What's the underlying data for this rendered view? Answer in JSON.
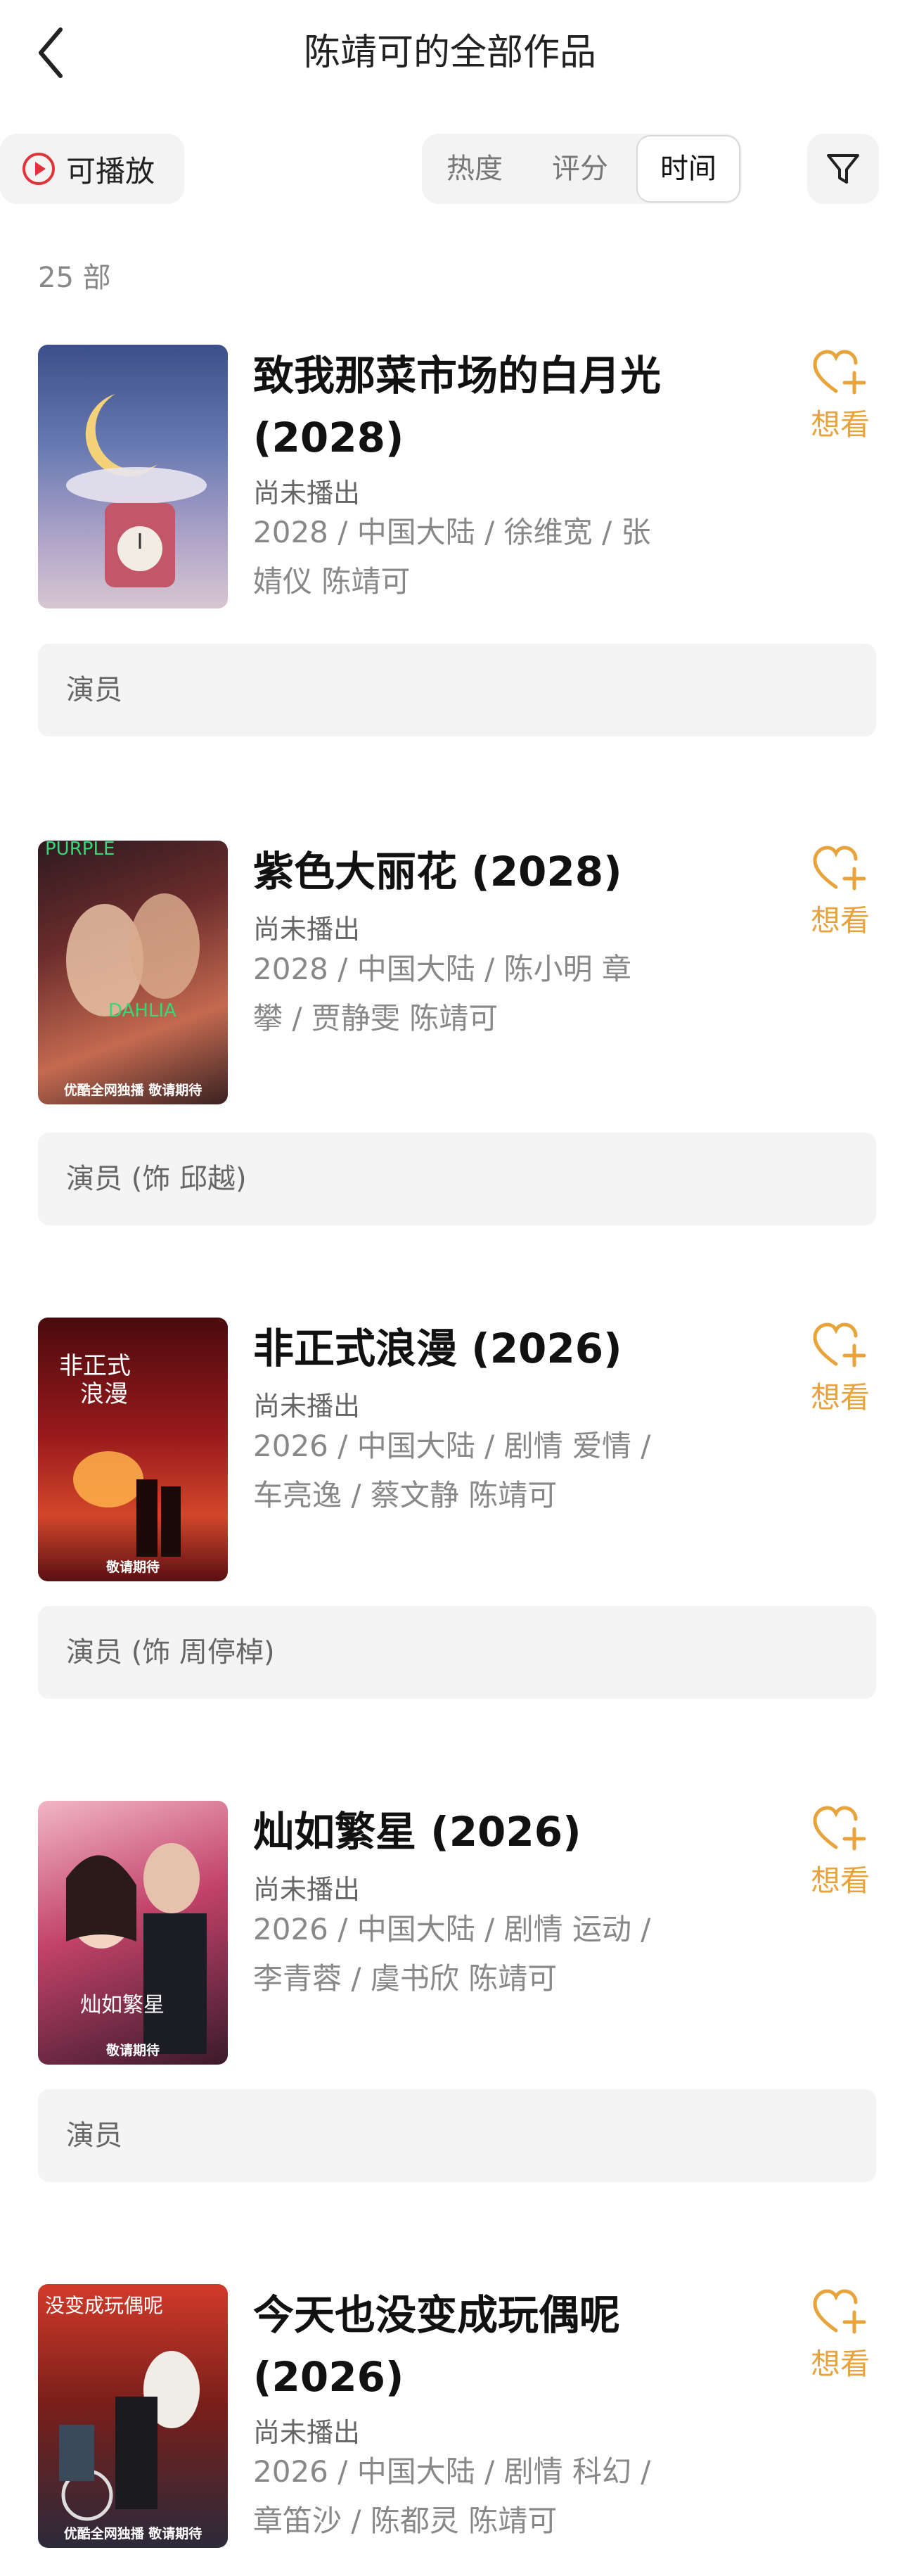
{
  "header": {
    "title": "陈靖可的全部作品"
  },
  "toolbar": {
    "playable_label": "可播放",
    "sort_tabs": [
      "热度",
      "评分",
      "时间"
    ],
    "active_sort": "时间"
  },
  "count_label": "25 部",
  "want_label": "想看",
  "colors": {
    "accent": "#e8a33a",
    "play_icon": "#e0343a"
  },
  "works": [
    {
      "title_line1": "致我那菜市场的白月光",
      "title_line2": "(2028)",
      "status": "尚未播出",
      "meta_line1": "2028 / 中国大陆 / 徐维宽 / 张",
      "meta_line2": "婧仪 陈靖可",
      "role": "演员",
      "poster_caption": ""
    },
    {
      "title_line1": "紫色大丽花 (2028)",
      "title_line2": "",
      "status": "尚未播出",
      "meta_line1": "2028 / 中国大陆 / 陈小明 章",
      "meta_line2": "攀 / 贾静雯 陈靖可",
      "role": "演员 (饰 邱越)",
      "poster_caption": "优酷全网独播 敬请期待"
    },
    {
      "title_line1": "非正式浪漫 (2026)",
      "title_line2": "",
      "status": "尚未播出",
      "meta_line1": "2026 / 中国大陆 / 剧情 爱情 /",
      "meta_line2": "车亮逸 / 蔡文静 陈靖可",
      "role": "演员 (饰 周停棹)",
      "poster_caption": "敬请期待"
    },
    {
      "title_line1": "灿如繁星 (2026)",
      "title_line2": "",
      "status": "尚未播出",
      "meta_line1": "2026 / 中国大陆 / 剧情 运动 /",
      "meta_line2": "李青蓉 / 虞书欣 陈靖可",
      "role": "演员",
      "poster_caption": "敬请期待"
    },
    {
      "title_line1": "今天也没变成玩偶呢",
      "title_line2": "(2026)",
      "status": "尚未播出",
      "meta_line1": "2026 / 中国大陆 / 剧情 科幻 /",
      "meta_line2": "章笛沙 / 陈都灵 陈靖可",
      "role": "",
      "poster_caption": "优酷全网独播 敬请期待"
    }
  ]
}
